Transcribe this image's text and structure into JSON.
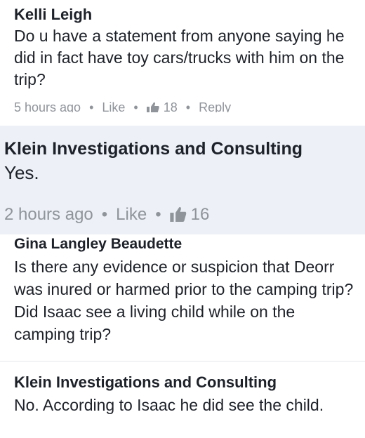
{
  "comments": [
    {
      "author": "Kelli Leigh",
      "text": "Do u have a statement from anyone saying he did in fact have toy cars/trucks with him on the trip?",
      "time": "5 hours ago",
      "like_label": "Like",
      "reaction_count": "18",
      "reply_label": "Reply",
      "separator": "•"
    },
    {
      "author": "Klein Investigations and Consulting",
      "text": "Yes.",
      "time": "2 hours ago",
      "like_label": "Like",
      "reaction_count": "16",
      "separator": "•"
    },
    {
      "author": "Gina Langley Beaudette",
      "text": "Is there any evidence or suspicion that Deorr was inured or harmed prior to the camping trip? Did Isaac see a living child while on the camping trip?"
    },
    {
      "author": "Klein Investigations and Consulting",
      "text": "No. According to Isaac he did see the child."
    }
  ],
  "colors": {
    "text": "#1d2129",
    "meta": "#8f949b",
    "highlight_bg": "#edf0f6"
  },
  "icons": {
    "reaction": "thumbs-up-icon"
  }
}
